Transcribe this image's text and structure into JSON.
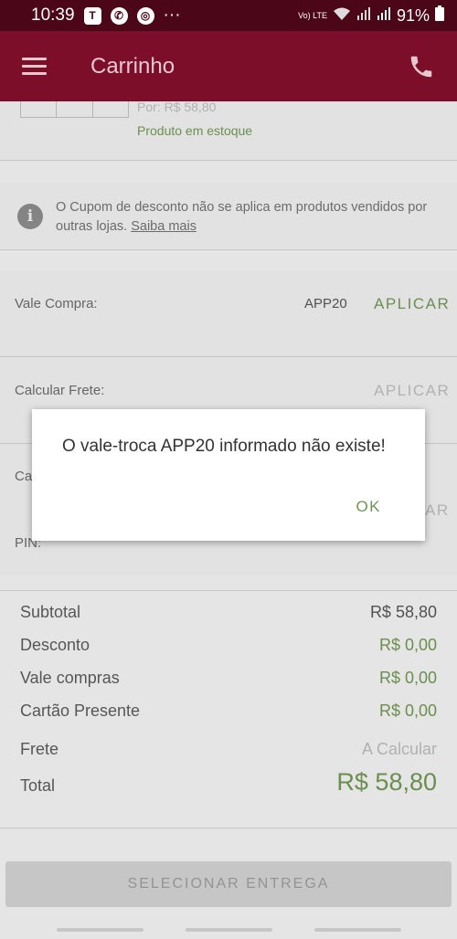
{
  "status_bar": {
    "time": "10:39",
    "more": "···",
    "volte": "Vo) LTE",
    "battery": "91%"
  },
  "app_bar": {
    "title": "Carrinho"
  },
  "product": {
    "price_label": "Por: R$  58,80",
    "stock_status": "Produto em estoque"
  },
  "coupon_notice": {
    "text": "O Cupom de desconto não se aplica em produtos vendidos por outras lojas.",
    "link": "Saiba mais"
  },
  "vale_compra": {
    "label": "Vale Compra:",
    "code": "APP20",
    "apply": "APLICAR"
  },
  "frete": {
    "label": "Calcular Frete:",
    "apply": "APLICAR"
  },
  "gift_card": {
    "label_partial": "Ca",
    "pin_label": "PIN:",
    "apply_partial": "AR"
  },
  "summary": {
    "subtotal_label": "Subtotal",
    "subtotal_value": "R$  58,80",
    "desconto_label": "Desconto",
    "desconto_value": "R$ 0,00",
    "vale_label": "Vale compras",
    "vale_value": "R$ 0,00",
    "cartao_label": "Cartão Presente",
    "cartao_value": "R$ 0,00",
    "frete_label": "Frete",
    "frete_value": "A Calcular",
    "total_label": "Total",
    "total_value": "R$  58,80"
  },
  "bottom_button": {
    "label": "SELECIONAR ENTREGA"
  },
  "dialog": {
    "message": "O vale-troca APP20 informado não existe!",
    "ok": "OK"
  },
  "colors": {
    "brand": "#7c0e29",
    "status_bar": "#4b0718",
    "green": "#6f9552"
  }
}
